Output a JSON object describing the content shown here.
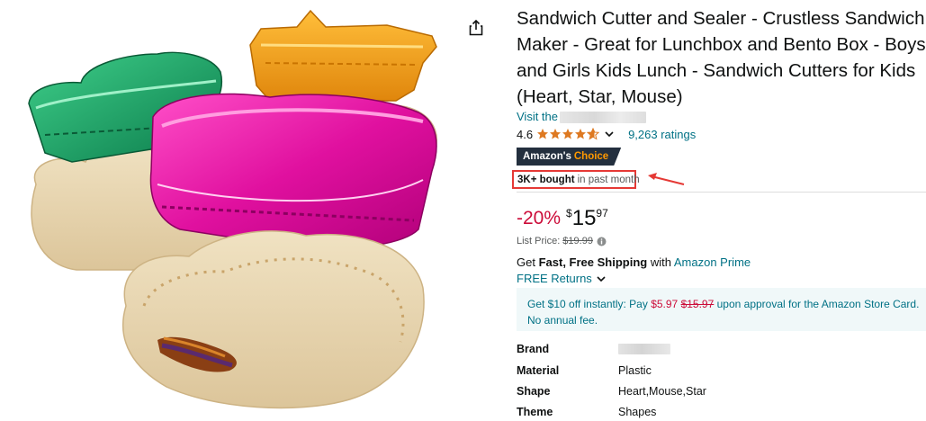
{
  "product": {
    "title": "Sandwich Cutter and Sealer - Crustless Sandwich Maker - Great for Lunchbox and Bento Box - Boys and Girls Kids Lunch - Sandwich Cutters for Kids (Heart, Star, Mouse)",
    "store_link_prefix": "Visit the",
    "rating_value": "4.6",
    "rating_stars": 4.6,
    "ratings_count": "9,263 ratings",
    "badge_label_1": "Amazon's",
    "badge_label_2": "Choice",
    "bought_strong": "3K+ bought",
    "bought_rest": "in past month"
  },
  "price": {
    "discount": "-20%",
    "symbol": "$",
    "whole": "15",
    "fraction": "97",
    "list_price_label": "List Price:",
    "list_price_value": "$19.99"
  },
  "shipping": {
    "get": "Get",
    "fast_free": "Fast, Free Shipping",
    "with": "with",
    "prime_link": "Amazon Prime",
    "returns": "FREE Returns"
  },
  "promo": {
    "line_a": "Get $10 off instantly: Pay",
    "pay_price": "$5.97",
    "old_price": "$15.97",
    "line_b": "upon approval for the Amazon Store Card.",
    "line_c": "No annual fee."
  },
  "specs": [
    {
      "key": "Brand",
      "value": ""
    },
    {
      "key": "Material",
      "value": "Plastic"
    },
    {
      "key": "Shape",
      "value": "Heart,Mouse,Star"
    },
    {
      "key": "Theme",
      "value": "Shapes"
    }
  ],
  "colors": {
    "link": "#007185",
    "price_red": "#cc0c39",
    "badge_bg": "#232f3e",
    "badge_accent": "#ff9900",
    "star": "#de7921",
    "annotation_red": "#e53935"
  },
  "icons": {
    "share": "share-icon",
    "chevron": "chevron-down-icon",
    "info": "info-icon",
    "star": "star-icon"
  }
}
